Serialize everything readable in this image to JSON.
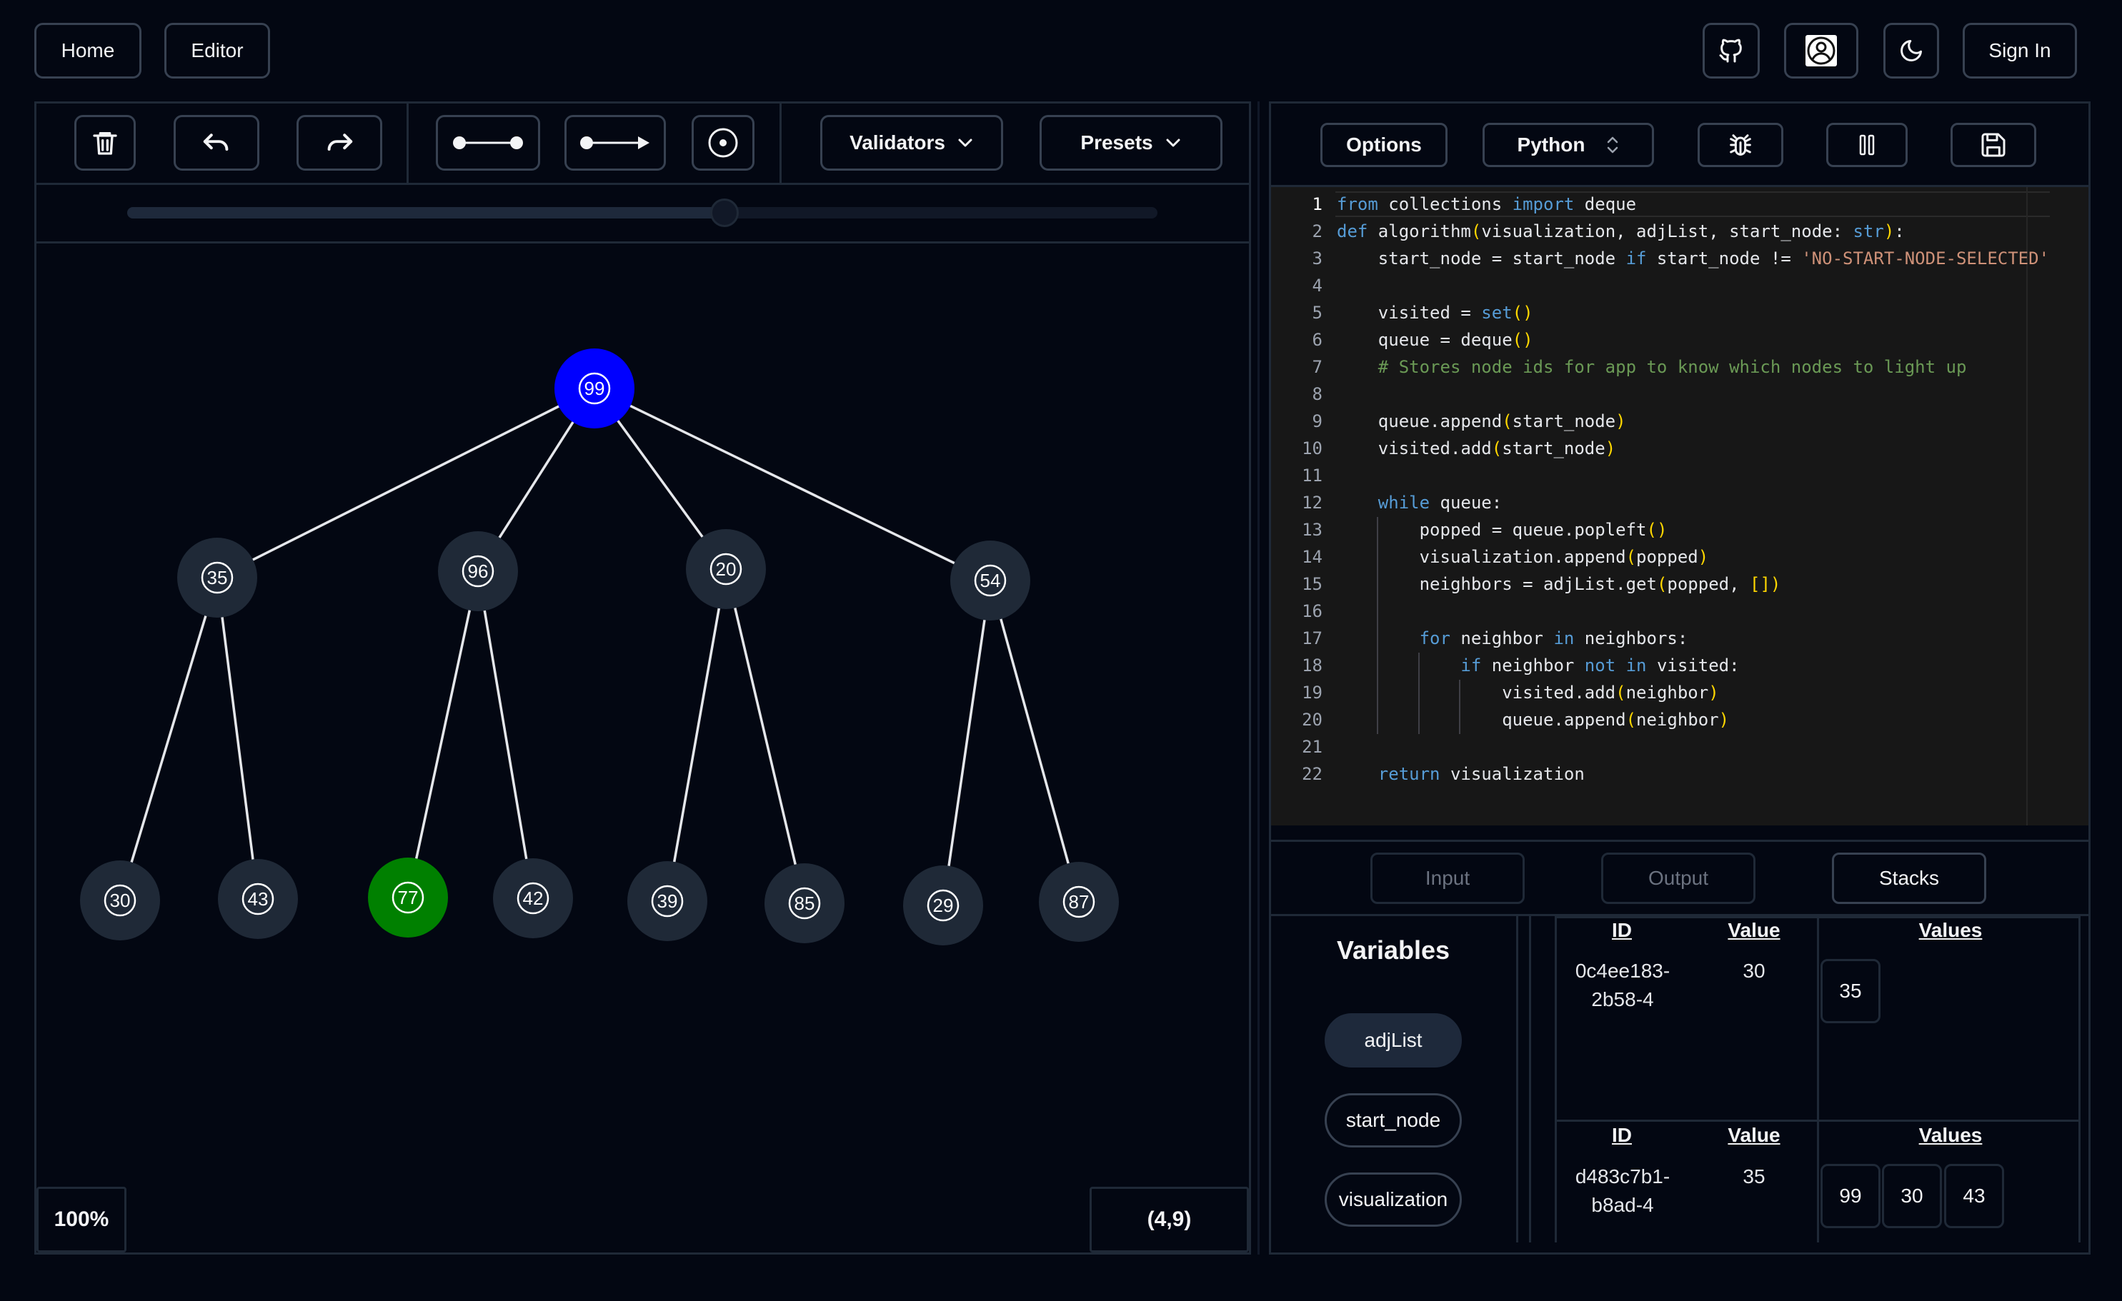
{
  "nav": {
    "home": "Home",
    "editor": "Editor",
    "sign_in": "Sign In"
  },
  "toolbar": {
    "validators": "Validators",
    "presets": "Presets"
  },
  "slider": {
    "fraction": 0.58
  },
  "graph": {
    "zoom": "100%",
    "coordinates": "(4,9)",
    "nodes": [
      {
        "label": "99",
        "color": "#0000ff"
      },
      {
        "label": "35",
        "color": "#1f2937"
      },
      {
        "label": "96",
        "color": "#1f2937"
      },
      {
        "label": "20",
        "color": "#1f2937"
      },
      {
        "label": "54",
        "color": "#1f2937"
      },
      {
        "label": "30",
        "color": "#1f2937"
      },
      {
        "label": "43",
        "color": "#1f2937"
      },
      {
        "label": "77",
        "color": "#008000"
      },
      {
        "label": "42",
        "color": "#1f2937"
      },
      {
        "label": "39",
        "color": "#1f2937"
      },
      {
        "label": "85",
        "color": "#1f2937"
      },
      {
        "label": "29",
        "color": "#1f2937"
      },
      {
        "label": "87",
        "color": "#1f2937"
      }
    ],
    "edges": [
      [
        "99",
        "35"
      ],
      [
        "99",
        "96"
      ],
      [
        "99",
        "20"
      ],
      [
        "99",
        "54"
      ],
      [
        "35",
        "30"
      ],
      [
        "35",
        "43"
      ],
      [
        "96",
        "77"
      ],
      [
        "96",
        "42"
      ],
      [
        "20",
        "39"
      ],
      [
        "20",
        "85"
      ],
      [
        "54",
        "29"
      ],
      [
        "54",
        "87"
      ]
    ]
  },
  "editor": {
    "options": "Options",
    "language": "Python",
    "code_lines": [
      "from collections import deque",
      "def algorithm(visualization, adjList, start_node: str):",
      "    start_node = start_node if start_node != 'NO-START-NODE-SELECTED'",
      "",
      "    visited = set()",
      "    queue = deque()",
      "    # Stores node ids for app to know which nodes to light up",
      "",
      "    queue.append(start_node)",
      "    visited.add(start_node)",
      "",
      "    while queue:",
      "        popped = queue.popleft()",
      "        visualization.append(popped)",
      "        neighbors = adjList.get(popped, [])",
      "",
      "        for neighbor in neighbors:",
      "            if neighbor not in visited:",
      "                visited.add(neighbor)",
      "                queue.append(neighbor)",
      "",
      "    return visualization"
    ],
    "line_numbers": [
      "1",
      "2",
      "3",
      "4",
      "5",
      "6",
      "7",
      "8",
      "9",
      "10",
      "11",
      "12",
      "13",
      "14",
      "15",
      "16",
      "17",
      "18",
      "19",
      "20",
      "21",
      "22"
    ]
  },
  "bottom_tabs": {
    "input": "Input",
    "output": "Output",
    "stacks": "Stacks"
  },
  "variables": {
    "title": "Variables",
    "items": [
      "adjList",
      "start_node",
      "visualization"
    ]
  },
  "stacks": {
    "header_id": "ID",
    "header_value": "Value",
    "header_values": "Values",
    "rows": [
      {
        "id": "0c4ee183-\n2b58-4",
        "value": "30",
        "values": [
          "35"
        ]
      },
      {
        "id": "d483c7b1-\nb8ad-4",
        "value": "35",
        "values": [
          "99",
          "30",
          "43"
        ]
      }
    ]
  }
}
